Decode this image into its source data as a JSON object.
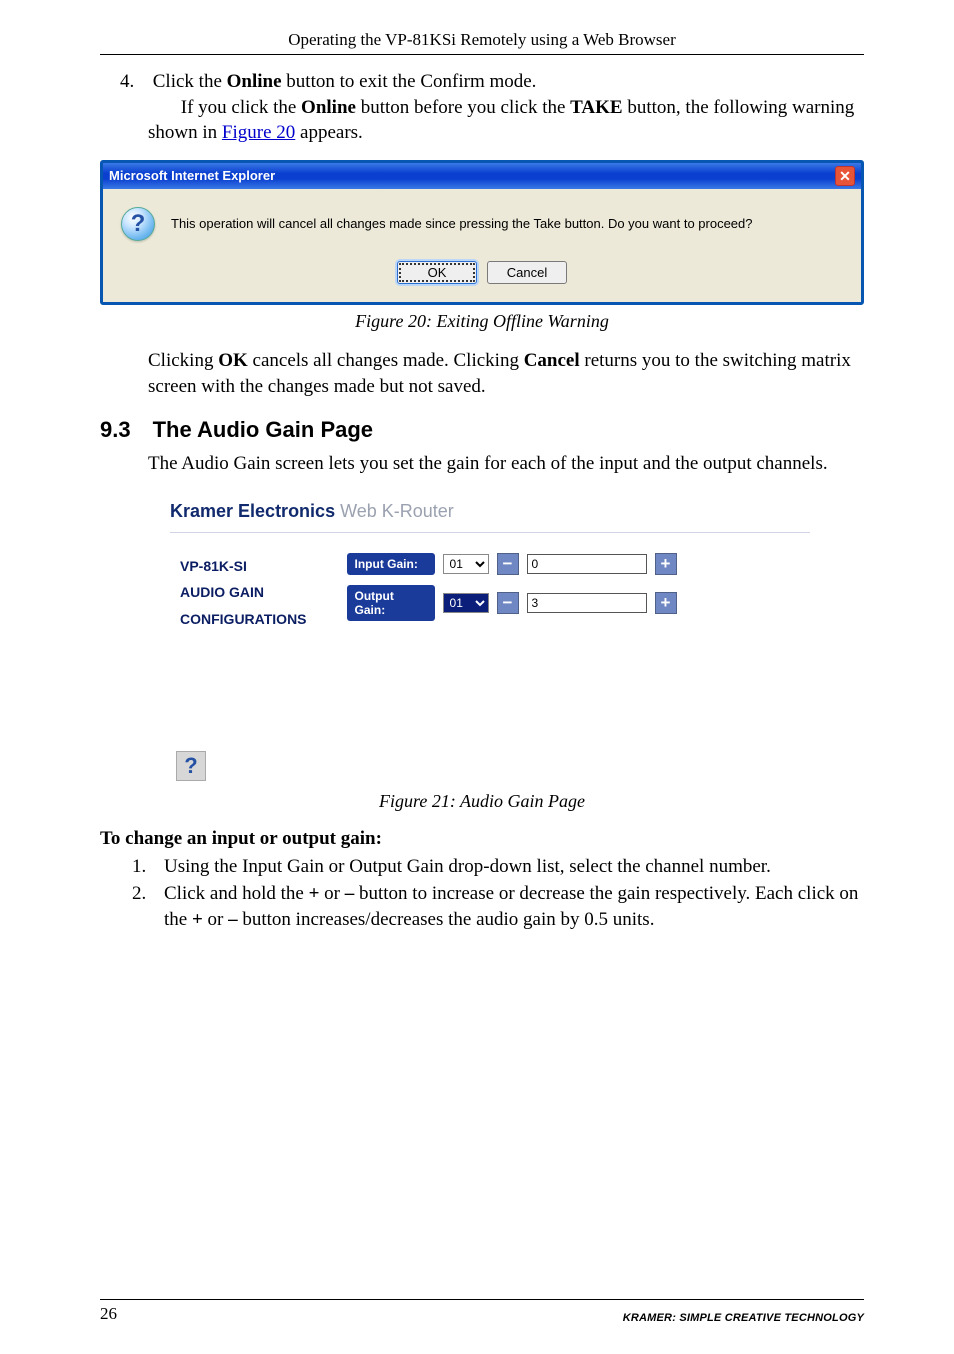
{
  "header": {
    "title": "Operating the VP-81KSi Remotely using a Web Browser"
  },
  "step4": {
    "marker": "4.",
    "line1_pre": "Click the ",
    "line1_bold": "Online",
    "line1_post": " button to exit the Confirm mode.",
    "line2_pre": "If you click the ",
    "line2_bold1": "Online",
    "line2_mid": " button before you click the ",
    "line2_bold2": "TAKE",
    "line2_post": " button, the following warning shown in ",
    "line2_link": "Figure 20",
    "line2_tail": " appears."
  },
  "dialog": {
    "title": "Microsoft Internet Explorer",
    "close_glyph": "✕",
    "question_glyph": "?",
    "message": "This operation will cancel all changes made since pressing the Take button. Do you want to proceed?",
    "ok_label": "OK",
    "cancel_label": "Cancel"
  },
  "fig20_caption": "Figure 20: Exiting Offline Warning",
  "afterFig20": {
    "pre": "Clicking ",
    "b1": "OK",
    "mid": " cancels all changes made. Clicking ",
    "b2": "Cancel",
    "post": " returns you to the switching matrix screen with the changes made but not saved."
  },
  "h93": {
    "num": "9.3",
    "title": "The Audio Gain Page"
  },
  "intro93": "The Audio Gain screen lets you set the gain for each of the input and the output channels.",
  "kramer": {
    "head_bold": "Kramer Electronics",
    "head_light": " Web K-Router",
    "nav": {
      "a": "VP-81K-SI",
      "b": "AUDIO GAIN",
      "c": "CONFIGURATIONS"
    },
    "rows": {
      "input": {
        "label": "Input Gain:",
        "select": "01",
        "minus": "−",
        "value": "0",
        "plus": "+"
      },
      "output": {
        "label": "Output Gain:",
        "select": "01",
        "minus": "−",
        "value": "3",
        "plus": "+"
      }
    },
    "help_glyph": "?"
  },
  "fig21_caption": "Figure 21: Audio Gain Page",
  "change_heading": "To change an input or output gain:",
  "steps2": {
    "s1": {
      "num": "1.",
      "text": "Using the Input Gain or Output Gain drop-down list, select the channel number."
    },
    "s2": {
      "num": "2.",
      "t1": "Click and hold the ",
      "b1": "+",
      "t2": " or ",
      "b2": "–",
      "t3": " button to increase or decrease the gain respectively. Each click on the ",
      "b3": "+",
      "t4": " or ",
      "b4": "–",
      "t5": " button increases/decreases the audio gain by 0.5 units."
    }
  },
  "footer": {
    "page": "26",
    "brand": "KRAMER:  SIMPLE CREATIVE TECHNOLOGY"
  }
}
